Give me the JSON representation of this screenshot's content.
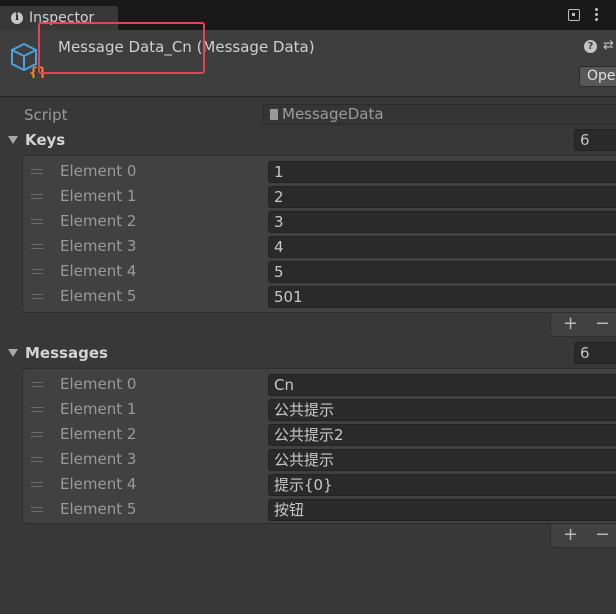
{
  "window": {
    "tab_title": "Inspector"
  },
  "header": {
    "object_title": "Message Data_Cn (Message Data)",
    "open_label": "Ope"
  },
  "script_row": {
    "label": "Script",
    "value": "MessageData"
  },
  "keys": {
    "title": "Keys",
    "size": "6",
    "elements": [
      {
        "label": "Element 0",
        "value": "1"
      },
      {
        "label": "Element 1",
        "value": "2"
      },
      {
        "label": "Element 2",
        "value": "3"
      },
      {
        "label": "Element 3",
        "value": "4"
      },
      {
        "label": "Element 4",
        "value": "5"
      },
      {
        "label": "Element 5",
        "value": "501"
      }
    ]
  },
  "messages": {
    "title": "Messages",
    "size": "6",
    "elements": [
      {
        "label": "Element 0",
        "value": "Cn"
      },
      {
        "label": "Element 1",
        "value": "公共提示"
      },
      {
        "label": "Element 2",
        "value": "公共提示2"
      },
      {
        "label": "Element 3",
        "value": "公共提示"
      },
      {
        "label": "Element 4",
        "value": "提示{0}"
      },
      {
        "label": "Element 5",
        "value": "按钮"
      }
    ]
  },
  "list_controls": {
    "add": "+",
    "remove": "−"
  },
  "colors": {
    "highlight": "#e0455b",
    "icon_blue": "#4aa3df",
    "icon_orange": "#f08a24"
  }
}
